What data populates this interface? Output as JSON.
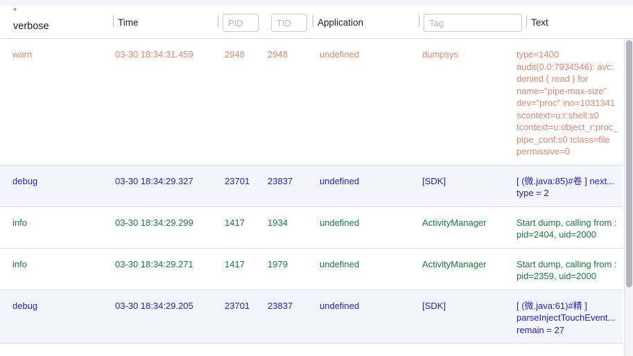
{
  "filter_bar": {
    "level_filter": {
      "value": "verbose",
      "caret_icon": "chevron-down-icon"
    },
    "columns": [
      {
        "key": "time",
        "label": "Time"
      },
      {
        "key": "application",
        "label": "Application"
      },
      {
        "key": "text",
        "label": "Text"
      }
    ],
    "pid_input": {
      "placeholder": "PID",
      "value": ""
    },
    "tid_input": {
      "placeholder": "TID",
      "value": ""
    },
    "tag_input": {
      "placeholder": "Tag",
      "value": ""
    }
  },
  "table": {
    "headers": {
      "level": "verbose",
      "time": "Time",
      "pid": "PID",
      "tid": "TID",
      "application": "Application",
      "tag": "Tag",
      "text": "Text"
    },
    "rows": [
      {
        "level": "warn",
        "time": "03-30 18:34:31.459",
        "pid": "2948",
        "tid": "2948",
        "application": "undefined",
        "tag": "dumpsys",
        "text": "type=1400 audit(0.0:7934546): avc: denied { read } for name=\"pipe-max-size\" dev=\"proc\" ino=1031341 scontext=u:r:shell:s0 tcontext=u:object_r:proc_pipe_conf:s0 tclass=file permissive=0"
      },
      {
        "level": "debug",
        "time": "03-30 18:34:29.327",
        "pid": "23701",
        "tid": "23837",
        "application": "undefined",
        "tag": "[SDK]",
        "text": "[ (微.java:85)#卷 ] next... type = 2"
      },
      {
        "level": "info",
        "time": "03-30 18:34:29.299",
        "pid": "1417",
        "tid": "1934",
        "application": "undefined",
        "tag": "ActivityManager",
        "text": "Start dump, calling from : pid=2404, uid=2000"
      },
      {
        "level": "info",
        "time": "03-30 18:34:29.271",
        "pid": "1417",
        "tid": "1979",
        "application": "undefined",
        "tag": "ActivityManager",
        "text": "Start dump, calling from : pid=2359, uid=2000"
      },
      {
        "level": "debug",
        "time": "03-30 18:34:29.205",
        "pid": "23701",
        "tid": "23837",
        "application": "undefined",
        "tag": "[SDK]",
        "text": "[ (微.java:61)#精 ] parseInjectTouchEvent... remain = 27"
      }
    ]
  },
  "colors": {
    "warn": "#e0886f",
    "debug": "#2222bb",
    "info": "#167a3c",
    "row_shade": "#f4f4fc",
    "separator": "#dcdce2"
  }
}
